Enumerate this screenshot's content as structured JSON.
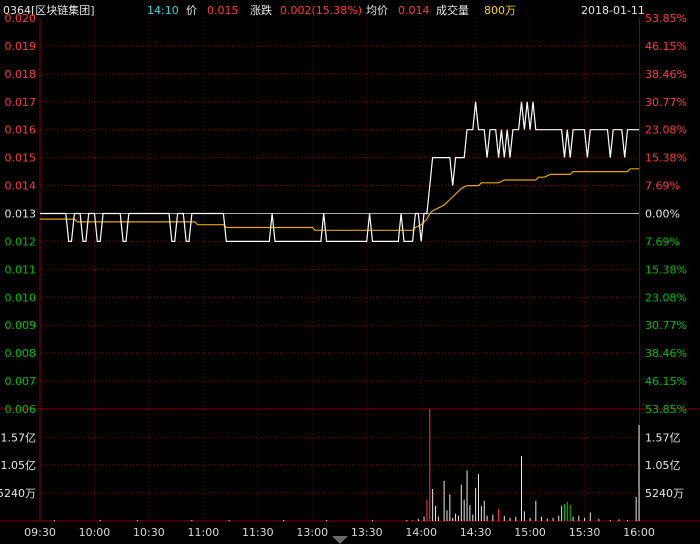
{
  "header": {
    "stock": "0364[区块链集团]",
    "time": "14:10",
    "price_label": "价",
    "price": "0.015",
    "change_label": "涨跌",
    "change": "0.002(15.38%)",
    "avg_label": "均价",
    "avg": "0.014",
    "volume_label": "成交量",
    "volume": "800万",
    "date": "2018-01-11"
  },
  "colors": {
    "up": "#ff3b3b",
    "down": "#00c000",
    "price_line": "#ffffff",
    "avg_line": "#e7a500",
    "grid": "#8a0000"
  },
  "chart_data": {
    "type": "line",
    "x_tick_labels": [
      "09:30",
      "10:00",
      "10:30",
      "11:00",
      "11:30",
      "13:00",
      "13:30",
      "14:00",
      "14:30",
      "15:00",
      "15:30",
      "16:00"
    ],
    "price_axis_labels": [
      "0.020",
      "0.019",
      "0.018",
      "0.017",
      "0.016",
      "0.015",
      "0.014",
      "0.013",
      "0.012",
      "0.011",
      "0.010",
      "0.009",
      "0.008",
      "0.007",
      "0.006"
    ],
    "pct_axis_labels": [
      "53.85%",
      "46.15%",
      "38.46%",
      "30.77%",
      "23.08%",
      "15.38%",
      "7.69%",
      "0.00%",
      "7.69%",
      "15.38%",
      "23.08%",
      "30.77%",
      "38.46%",
      "46.15%",
      "53.85%"
    ],
    "ylim": [
      0.006,
      0.02
    ],
    "prev_close": 0.013,
    "volume_axis_labels": [
      "1.57亿",
      "1.05亿",
      "5240万"
    ],
    "volume_axis_values": [
      157000000,
      105000000,
      52400000
    ],
    "volume_max": 210000000,
    "price_series": [
      [
        0,
        0.013
      ],
      [
        9,
        0.013
      ],
      [
        10,
        0.012
      ],
      [
        11,
        0.012
      ],
      [
        12,
        0.013
      ],
      [
        14,
        0.013
      ],
      [
        15,
        0.012
      ],
      [
        16,
        0.012
      ],
      [
        17,
        0.013
      ],
      [
        19,
        0.013
      ],
      [
        20,
        0.012
      ],
      [
        21,
        0.012
      ],
      [
        22,
        0.013
      ],
      [
        28,
        0.013
      ],
      [
        29,
        0.012
      ],
      [
        30,
        0.012
      ],
      [
        31,
        0.013
      ],
      [
        45,
        0.013
      ],
      [
        46,
        0.012
      ],
      [
        47,
        0.012
      ],
      [
        48,
        0.013
      ],
      [
        50,
        0.013
      ],
      [
        51,
        0.012
      ],
      [
        52,
        0.012
      ],
      [
        53,
        0.013
      ],
      [
        64,
        0.013
      ],
      [
        65,
        0.012
      ],
      [
        80,
        0.012
      ],
      [
        81,
        0.013
      ],
      [
        82,
        0.012
      ],
      [
        98,
        0.012
      ],
      [
        99,
        0.013
      ],
      [
        100,
        0.012
      ],
      [
        114,
        0.012
      ],
      [
        115,
        0.013
      ],
      [
        116,
        0.012
      ],
      [
        125,
        0.012
      ],
      [
        126,
        0.013
      ],
      [
        127,
        0.012
      ],
      [
        130,
        0.012
      ],
      [
        131,
        0.013
      ],
      [
        132,
        0.013
      ],
      [
        133,
        0.012
      ],
      [
        134,
        0.013
      ],
      [
        135,
        0.013
      ],
      [
        136,
        0.014
      ],
      [
        137,
        0.015
      ],
      [
        143,
        0.015
      ],
      [
        144,
        0.014
      ],
      [
        145,
        0.015
      ],
      [
        148,
        0.015
      ],
      [
        149,
        0.016
      ],
      [
        151,
        0.016
      ],
      [
        152,
        0.017
      ],
      [
        153,
        0.016
      ],
      [
        155,
        0.016
      ],
      [
        156,
        0.015
      ],
      [
        157,
        0.016
      ],
      [
        159,
        0.016
      ],
      [
        160,
        0.015
      ],
      [
        161,
        0.016
      ],
      [
        162,
        0.015
      ],
      [
        163,
        0.016
      ],
      [
        164,
        0.015
      ],
      [
        165,
        0.016
      ],
      [
        167,
        0.016
      ],
      [
        168,
        0.017
      ],
      [
        169,
        0.016
      ],
      [
        170,
        0.017
      ],
      [
        171,
        0.016
      ],
      [
        172,
        0.017
      ],
      [
        173,
        0.016
      ],
      [
        182,
        0.016
      ],
      [
        183,
        0.015
      ],
      [
        184,
        0.016
      ],
      [
        185,
        0.015
      ],
      [
        186,
        0.016
      ],
      [
        190,
        0.016
      ],
      [
        191,
        0.015
      ],
      [
        192,
        0.016
      ],
      [
        198,
        0.016
      ],
      [
        199,
        0.015
      ],
      [
        200,
        0.016
      ],
      [
        203,
        0.016
      ],
      [
        204,
        0.015
      ],
      [
        205,
        0.016
      ],
      [
        209,
        0.016
      ]
    ],
    "avg_series": [
      [
        0,
        0.0128
      ],
      [
        12,
        0.0128
      ],
      [
        13,
        0.0127
      ],
      [
        20,
        0.0127
      ],
      [
        23,
        0.0127
      ],
      [
        54,
        0.0127
      ],
      [
        55,
        0.0126
      ],
      [
        64,
        0.0126
      ],
      [
        65,
        0.0125
      ],
      [
        95,
        0.0125
      ],
      [
        96,
        0.0124
      ],
      [
        120,
        0.0124
      ],
      [
        121,
        0.0124
      ],
      [
        130,
        0.0124
      ],
      [
        131,
        0.0125
      ],
      [
        133,
        0.0126
      ],
      [
        134,
        0.0127
      ],
      [
        135,
        0.0128
      ],
      [
        136,
        0.013
      ],
      [
        137,
        0.0131
      ],
      [
        139,
        0.0132
      ],
      [
        141,
        0.0133
      ],
      [
        143,
        0.0135
      ],
      [
        145,
        0.0137
      ],
      [
        146,
        0.0138
      ],
      [
        147,
        0.0139
      ],
      [
        149,
        0.014
      ],
      [
        153,
        0.014
      ],
      [
        154,
        0.0141
      ],
      [
        160,
        0.0141
      ],
      [
        162,
        0.0142
      ],
      [
        173,
        0.0142
      ],
      [
        174,
        0.0143
      ],
      [
        176,
        0.0143
      ],
      [
        178,
        0.0144
      ],
      [
        185,
        0.0144
      ],
      [
        186,
        0.0145
      ],
      [
        205,
        0.0145
      ],
      [
        206,
        0.0146
      ],
      [
        209,
        0.0146
      ]
    ],
    "volume_bars": [
      {
        "t": 5,
        "v": 0.4,
        "c": "w"
      },
      {
        "t": 21,
        "v": 0.4,
        "c": "w"
      },
      {
        "t": 34,
        "v": 0.5,
        "c": "w"
      },
      {
        "t": 53,
        "v": 0.4,
        "c": "w"
      },
      {
        "t": 66,
        "v": 0.3,
        "c": "w"
      },
      {
        "t": 85,
        "v": 0.4,
        "c": "w"
      },
      {
        "t": 100,
        "v": 0.3,
        "c": "w"
      },
      {
        "t": 116,
        "v": 0.3,
        "c": "w"
      },
      {
        "t": 128,
        "v": 1,
        "c": "w"
      },
      {
        "t": 130,
        "v": 2,
        "c": "r"
      },
      {
        "t": 132,
        "v": 4,
        "c": "w"
      },
      {
        "t": 134,
        "v": 8,
        "c": "w"
      },
      {
        "t": 135,
        "v": 40,
        "c": "r"
      },
      {
        "t": 136,
        "v": 210,
        "c": "r"
      },
      {
        "t": 137,
        "v": 60,
        "c": "w"
      },
      {
        "t": 138,
        "v": 28,
        "c": "w"
      },
      {
        "t": 139,
        "v": 8,
        "c": "w"
      },
      {
        "t": 141,
        "v": 75,
        "c": "w"
      },
      {
        "t": 142,
        "v": 20,
        "c": "w"
      },
      {
        "t": 143,
        "v": 50,
        "c": "w"
      },
      {
        "t": 144,
        "v": 6,
        "c": "w"
      },
      {
        "t": 145,
        "v": 14,
        "c": "w"
      },
      {
        "t": 146,
        "v": 10,
        "c": "w"
      },
      {
        "t": 147,
        "v": 68,
        "c": "w"
      },
      {
        "t": 148,
        "v": 40,
        "c": "w"
      },
      {
        "t": 149,
        "v": 95,
        "c": "w"
      },
      {
        "t": 150,
        "v": 30,
        "c": "w"
      },
      {
        "t": 151,
        "v": 12,
        "c": "w"
      },
      {
        "t": 152,
        "v": 62,
        "c": "w"
      },
      {
        "t": 153,
        "v": 88,
        "c": "w"
      },
      {
        "t": 154,
        "v": 28,
        "c": "w"
      },
      {
        "t": 155,
        "v": 38,
        "c": "w"
      },
      {
        "t": 156,
        "v": 10,
        "c": "w"
      },
      {
        "t": 158,
        "v": 12,
        "c": "w"
      },
      {
        "t": 160,
        "v": 22,
        "c": "r"
      },
      {
        "t": 162,
        "v": 10,
        "c": "w"
      },
      {
        "t": 164,
        "v": 6,
        "c": "w"
      },
      {
        "t": 166,
        "v": 8,
        "c": "w"
      },
      {
        "t": 168,
        "v": 122,
        "c": "w"
      },
      {
        "t": 169,
        "v": 18,
        "c": "w"
      },
      {
        "t": 171,
        "v": 6,
        "c": "w"
      },
      {
        "t": 173,
        "v": 38,
        "c": "w"
      },
      {
        "t": 175,
        "v": 8,
        "c": "w"
      },
      {
        "t": 177,
        "v": 4,
        "c": "w"
      },
      {
        "t": 179,
        "v": 6,
        "c": "w"
      },
      {
        "t": 181,
        "v": 10,
        "c": "w"
      },
      {
        "t": 182,
        "v": 28,
        "c": "w"
      },
      {
        "t": 183,
        "v": 32,
        "c": "g"
      },
      {
        "t": 184,
        "v": 36,
        "c": "g"
      },
      {
        "t": 185,
        "v": 30,
        "c": "g"
      },
      {
        "t": 186,
        "v": 8,
        "c": "w"
      },
      {
        "t": 188,
        "v": 10,
        "c": "w"
      },
      {
        "t": 190,
        "v": 6,
        "c": "w"
      },
      {
        "t": 192,
        "v": 16,
        "c": "w"
      },
      {
        "t": 195,
        "v": 4,
        "c": "w"
      },
      {
        "t": 199,
        "v": 2,
        "c": "w"
      },
      {
        "t": 202,
        "v": 3,
        "c": "w"
      },
      {
        "t": 205,
        "v": 2,
        "c": "w"
      },
      {
        "t": 208,
        "v": 45,
        "c": "w"
      },
      {
        "t": 209,
        "v": 180,
        "c": "w"
      }
    ]
  }
}
